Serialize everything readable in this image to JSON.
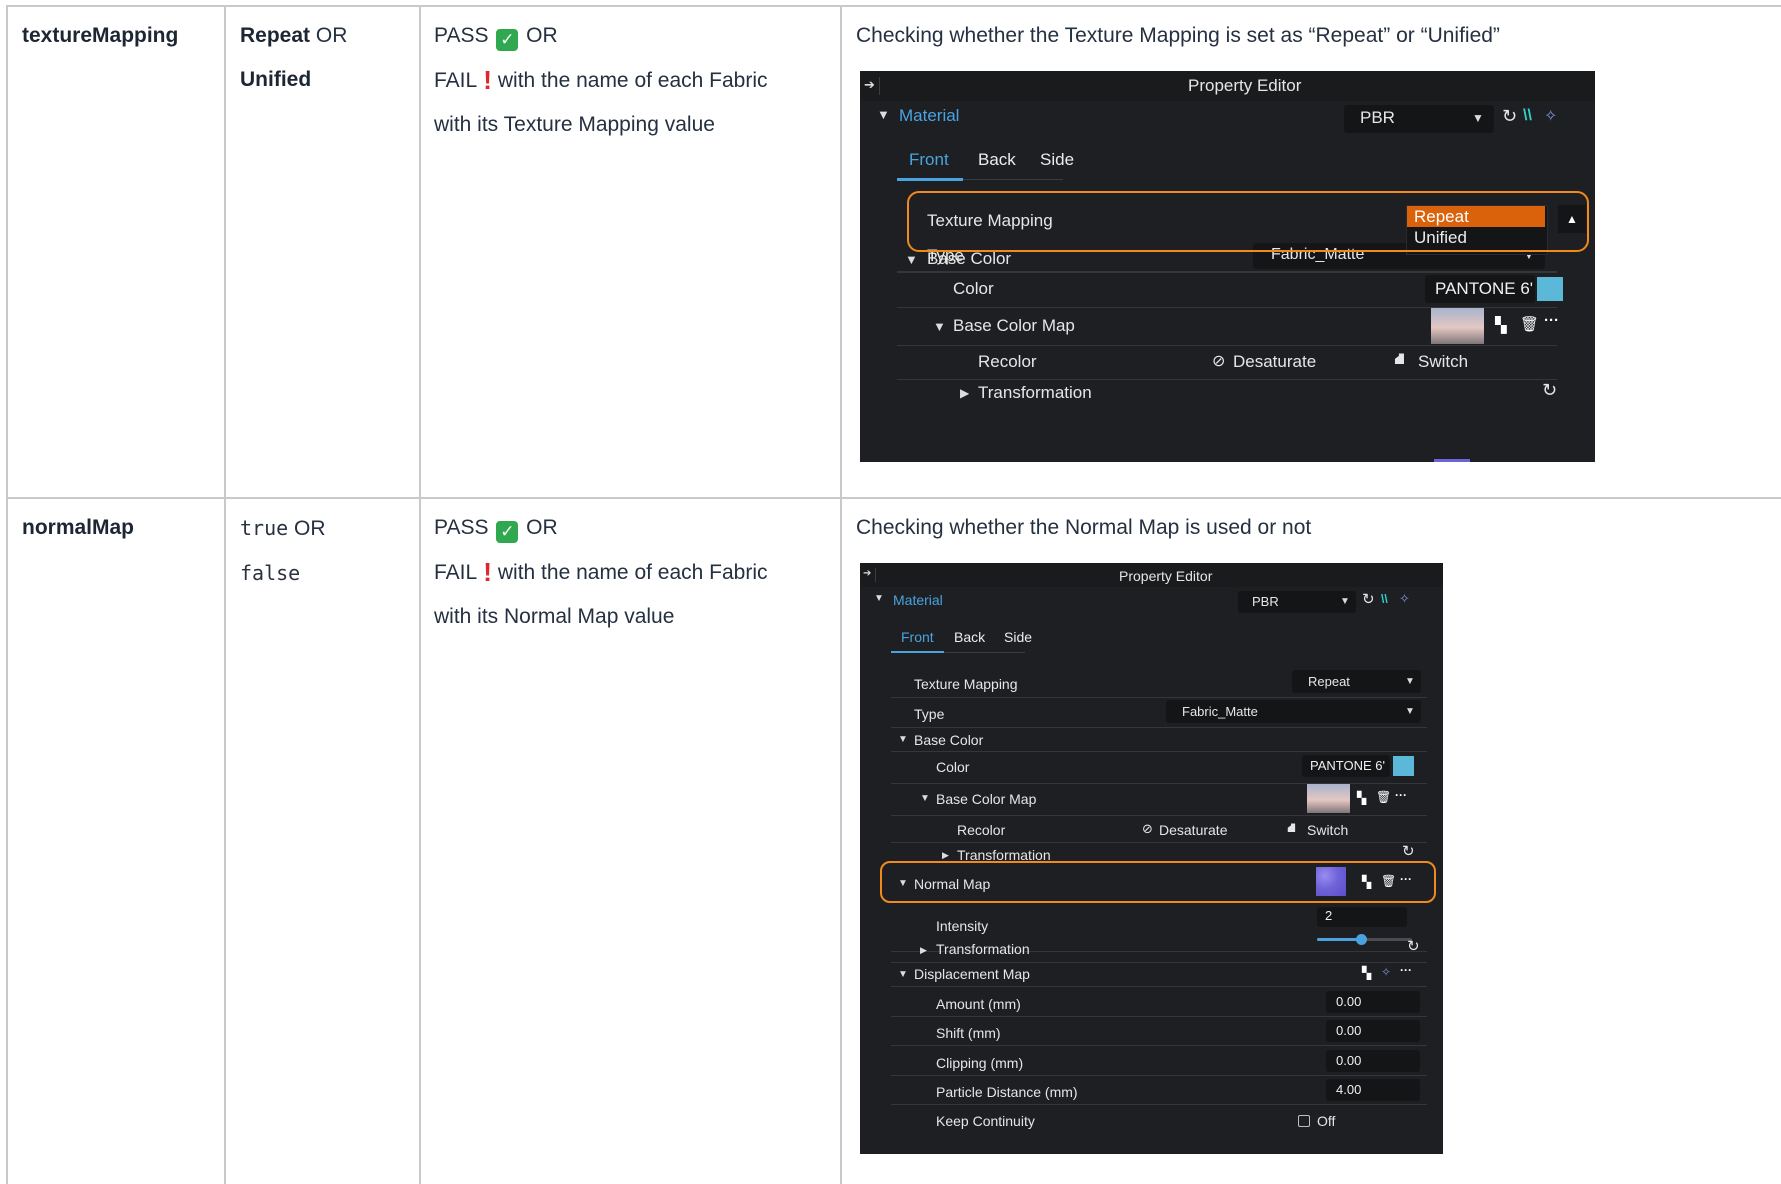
{
  "rows": [
    {
      "parameter": "textureMapping",
      "values": {
        "first": "Repeat",
        "or": "OR",
        "second": "Unified"
      },
      "result": {
        "pass": "PASS",
        "pass_or": "OR",
        "fail": "FAIL",
        "fail_text": "with the name of each Fabric",
        "line3": "with its Texture Mapping value"
      },
      "description": "Checking whether the Texture Mapping is set as “Repeat” or “Unified”"
    },
    {
      "parameter": "normalMap",
      "values": {
        "first": "true",
        "or": "OR",
        "second": "false"
      },
      "result": {
        "pass": "PASS",
        "pass_or": "OR",
        "fail": "FAIL",
        "fail_text": "with the name of each Fabric",
        "line3": "with its Normal Map value"
      },
      "description": "Checking whether the Normal Map is used or not"
    }
  ],
  "editor1": {
    "title": "Property Editor",
    "section": "Material",
    "material_type": "PBR",
    "tabs": [
      "Front",
      "Back",
      "Side"
    ],
    "texture_mapping_label": "Texture Mapping",
    "dropdown_options": [
      "Repeat",
      "Unified"
    ],
    "type_label": "Type",
    "type_value": "Fabric_Matte",
    "base_color_label": "Base Color",
    "color_label": "Color",
    "color_value": "PANTONE 6'",
    "base_color_map_label": "Base Color Map",
    "recolor_label": "Recolor",
    "desaturate_label": "Desaturate",
    "switch_label": "Switch",
    "transformation_label": "Transformation",
    "accent_color": "#4aa3df",
    "highlight_color": "#f08a1c",
    "selected_option_color": "#d9620b",
    "swatch_color": "#5bb8d8"
  },
  "editor2": {
    "title": "Property Editor",
    "section": "Material",
    "material_type": "PBR",
    "tabs": [
      "Front",
      "Back",
      "Side"
    ],
    "texture_mapping_label": "Texture Mapping",
    "texture_mapping_value": "Repeat",
    "type_label": "Type",
    "type_value": "Fabric_Matte",
    "base_color_label": "Base Color",
    "color_label": "Color",
    "color_value": "PANTONE 6'",
    "base_color_map_label": "Base Color Map",
    "recolor_label": "Recolor",
    "desaturate_label": "Desaturate",
    "switch_label": "Switch",
    "transformation_label": "Transformation",
    "normal_map_label": "Normal Map",
    "intensity_label": "Intensity",
    "intensity_value": "2",
    "transformation2_label": "Transformation",
    "displacement_label": "Displacement Map",
    "amount_label": "Amount (mm)",
    "amount_value": "0.00",
    "shift_label": "Shift (mm)",
    "shift_value": "0.00",
    "clipping_label": "Clipping (mm)",
    "clipping_value": "0.00",
    "particle_label": "Particle Distance (mm)",
    "particle_value": "4.00",
    "continuity_label": "Keep Continuity",
    "continuity_value": "Off"
  }
}
